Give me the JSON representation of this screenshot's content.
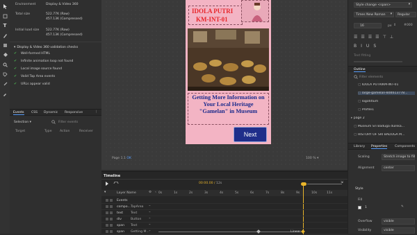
{
  "left": {
    "environment_label": "Environment",
    "environment_value": "Display & Video 360",
    "total_size_label": "Total size",
    "total_size_raw": "522.77K (Raw)",
    "total_size_compressed": "457.13K (Compressed)",
    "initial_load_label": "Initial load size",
    "initial_load_raw": "522.77K (Raw)",
    "initial_load_compressed": "457.13K (Compressed)",
    "checks_header": "Display & Video 360 validation checks",
    "checks": [
      "Well-formed HTML",
      "Infinite animation loop not found",
      "Local image source found",
      "Valid Tap Area events",
      "URLs appear valid"
    ],
    "events_tabs": [
      "Events",
      "CSS",
      "Dynamic",
      "Responsive"
    ],
    "selection_label": "Selection",
    "filter_placeholder": "Filter events",
    "event_columns": [
      "Target",
      "Type",
      "Action",
      "Receiver"
    ]
  },
  "banner": {
    "title_line1": "IDOLA PUTRI",
    "title_line2": "KM-INT-01",
    "headline": "Getting More Information on Your Local Heritage \"Gamelan\" in Museum",
    "next_button": "Next",
    "page_indicator": "Page 1.1",
    "page_mode": "OK",
    "zoom": "100 %"
  },
  "timeline": {
    "title": "Timeline",
    "timecode": "00:00.00",
    "duration": "12s",
    "layer_name_header": "Layer Name",
    "ticks": [
      "0s",
      "1s",
      "2s",
      "3s",
      "4s",
      "5s",
      "6s",
      "7s",
      "8s",
      "9s",
      "10s",
      "11s"
    ],
    "layers": [
      {
        "name": "Events",
        "type": ""
      },
      {
        "name": "compo...",
        "type": "TapArea"
      },
      {
        "name": "text",
        "type": "Text"
      },
      {
        "name": "div",
        "type": "Button"
      },
      {
        "name": "span",
        "type": "Text"
      },
      {
        "name": "span",
        "type": "Getting M..."
      }
    ],
    "linear_label": "Linear"
  },
  "right": {
    "style_dropdown": "Style change <span>",
    "font_family": "Times New Roman",
    "font_weight": "Regular",
    "font_size": "16",
    "font_unit": "px",
    "text_fitting": "Text fitting",
    "outline_title": "Outline",
    "outline_filter_placeholder": "Filter elements",
    "outline_items": [
      "IDOLA PUTRIKM-INT-01",
      "large-gamelan-8d4613778...",
      "logotitlum",
      "Profile1",
      "page 2",
      "Museum Sri Baduga dulnka...",
      "HISTORY OF SRI BADUGA M..."
    ],
    "bottom_tabs": [
      "Library",
      "Properties",
      "Components"
    ],
    "scaling_label": "Scaling",
    "scaling_value": "Stretch image to fill",
    "alignment_label": "Alignment",
    "alignment_value": "center",
    "style_label": "Style",
    "fill_label": "Fill",
    "fill_value": "1",
    "overflow_label": "Overflow",
    "overflow_value": "visible",
    "visibility_label": "Visibility",
    "visibility_value": "visible"
  },
  "colors": {
    "page_bg": "#f3b4c4",
    "title_red": "#e8262b",
    "headline_blue": "#1a2a8c",
    "next_button_bg": "#1f2e8a",
    "accent_blue": "#5aa0ff",
    "keyframe_yellow": "#e9b52b",
    "check_green": "#4caf50"
  }
}
